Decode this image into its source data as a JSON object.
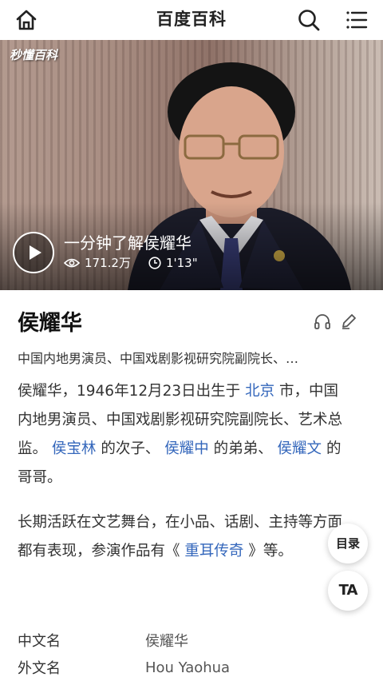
{
  "header": {
    "title": "百度百科",
    "home_icon": "home-icon",
    "search_icon": "search-icon",
    "menu_icon": "menu-icon"
  },
  "video": {
    "watermark": "秒懂百科",
    "title": "一分钟了解侯耀华",
    "views": "171.2万",
    "duration": "1'13\""
  },
  "entry": {
    "name": "侯耀华",
    "subtitle": "中国内地男演员、中国戏剧影视研究院副院长、…",
    "summary1": {
      "t1": "侯耀华，1946年12月23日出生于",
      "link_beijing": "北京",
      "t2": "市，中国内地男演员、中国戏剧影视研究院副院长、艺术总监。",
      "link_father": "侯宝林",
      "t3": "的次子、",
      "link_brother": "侯耀中",
      "t4": "的弟弟、",
      "link_sister": "侯耀文",
      "t5": "的哥哥。"
    },
    "summary2": {
      "t1": "长期活跃在文艺舞台，在小品、话剧、主持等方面都有表现，参演作品有《",
      "link_work": "重耳传奇",
      "t2": "》等。"
    }
  },
  "floating": {
    "toc_label": "目录",
    "ta_label": "TA"
  },
  "infobox": [
    {
      "key": "中文名",
      "value": "侯耀华"
    },
    {
      "key": "外文名",
      "value": "Hou Yaohua"
    }
  ],
  "colors": {
    "link": "#3366bb",
    "text": "#333333"
  }
}
